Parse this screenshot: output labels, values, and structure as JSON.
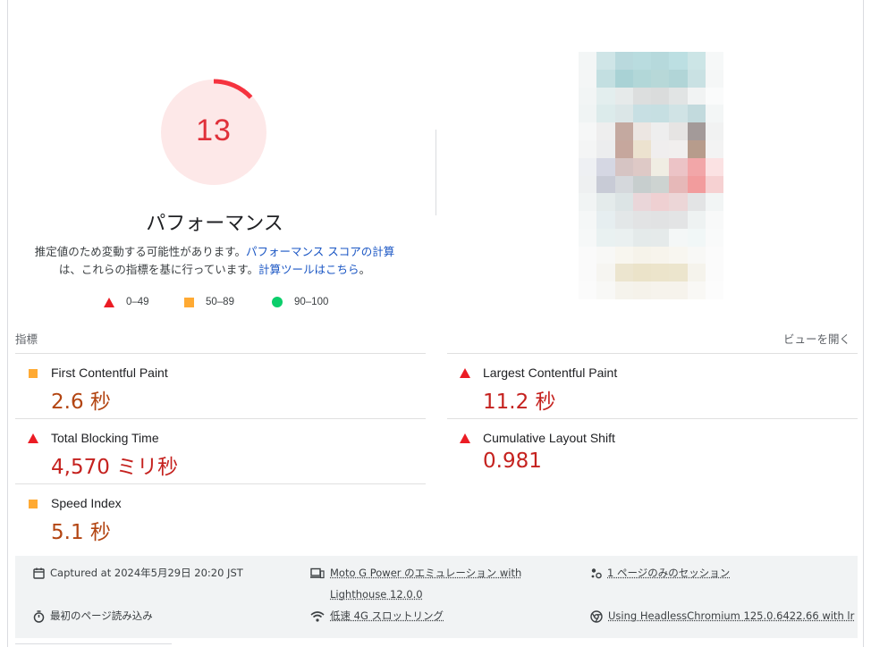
{
  "score": {
    "value": "13",
    "fraction": 0.13,
    "color": "#e0303a",
    "bg": "#fde8e8"
  },
  "category_title": "パフォーマンス",
  "description": {
    "line1_text": "推定値のため変動する可能性があります。",
    "line1_link": "パフォーマンス スコアの計算",
    "line2_text": "は、これらの指標を基に行っています。",
    "line2_link": "計算ツールはこちら",
    "line2_end": "。"
  },
  "legend": {
    "fail": "0–49",
    "average": "50–89",
    "pass": "90–100"
  },
  "metrics_header": {
    "label": "指標",
    "open_view": "ビューを開く"
  },
  "metrics": [
    {
      "name": "First Contentful Paint",
      "value": "2.6 秒",
      "rating": "average"
    },
    {
      "name": "Largest Contentful Paint",
      "value": "11.2 秒",
      "rating": "fail"
    },
    {
      "name": "Total Blocking Time",
      "value": "4,570 ミリ秒",
      "rating": "fail"
    },
    {
      "name": "Cumulative Layout Shift",
      "value": "0.981",
      "rating": "fail"
    },
    {
      "name": "Speed Index",
      "value": "5.1 秒",
      "rating": "average"
    }
  ],
  "runtime": {
    "captured": "Captured at 2024年5月29日 20:20 JST",
    "device": "Moto G Power のエミュレーション with",
    "device_line2": "Lighthouse 12.0.0",
    "session": "1 ページのみのセッション",
    "load": "最初のページ読み込み",
    "throttling": "低速 4G スロットリング",
    "browser": "Using HeadlessChromium 125.0.6422.66 with lr"
  },
  "colors": {
    "fail": "#eb1c24",
    "average": "#ffaa33",
    "pass": "#0cce6b",
    "link": "#1a56c4"
  },
  "icons": [
    "calendar-icon",
    "devices-icon",
    "session-icon",
    "timer-icon",
    "network-icon",
    "chrome-icon"
  ]
}
